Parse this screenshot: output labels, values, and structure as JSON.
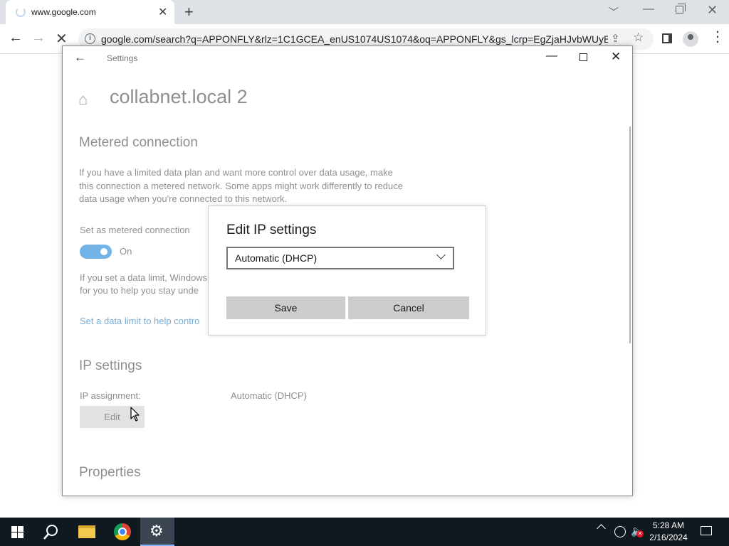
{
  "browser": {
    "tab_title": "www.google.com",
    "url": "google.com/search?q=APPONFLY&rlz=1C1GCEA_enUS1074US1074&oq=APPONFLY&gs_lcrp=EgZjaHJvbWUyBg...",
    "icons": [
      "loading-spinner-icon",
      "close-icon",
      "new-tab-icon",
      "back-arrow-icon",
      "forward-arrow-icon",
      "stop-icon",
      "site-info-icon",
      "share-icon",
      "star-icon",
      "side-panel-icon",
      "profile-icon",
      "menu-icon"
    ]
  },
  "settings": {
    "window_title": "Settings",
    "page_title": "collabnet.local 2",
    "metered": {
      "heading": "Metered connection",
      "description": "If you have a limited data plan and want more control over data usage, make this connection a metered network. Some apps might work differently to reduce data usage when you're connected to this network.",
      "toggle_label": "Set as metered connection",
      "toggle_state": "On",
      "data_limit_line1": "If you set a data limit, Windows",
      "data_limit_line2": "for you to help you stay unde",
      "data_limit_link": "Set a data limit to help contro"
    },
    "ip": {
      "heading": "IP settings",
      "assignment_label": "IP assignment:",
      "assignment_value": "Automatic (DHCP)",
      "edit_label": "Edit"
    },
    "properties_heading": "Properties"
  },
  "dialog": {
    "title": "Edit IP settings",
    "selected_option": "Automatic (DHCP)",
    "save_label": "Save",
    "cancel_label": "Cancel"
  },
  "taskbar": {
    "time": "5:28 AM",
    "date": "2/16/2024",
    "pinned": [
      "windows-start-icon",
      "search-icon",
      "file-explorer-icon",
      "chrome-icon",
      "settings-gear-icon"
    ]
  },
  "colors": {
    "accent": "#0078d7",
    "link": "#0067b8",
    "taskbar": "#101820"
  }
}
